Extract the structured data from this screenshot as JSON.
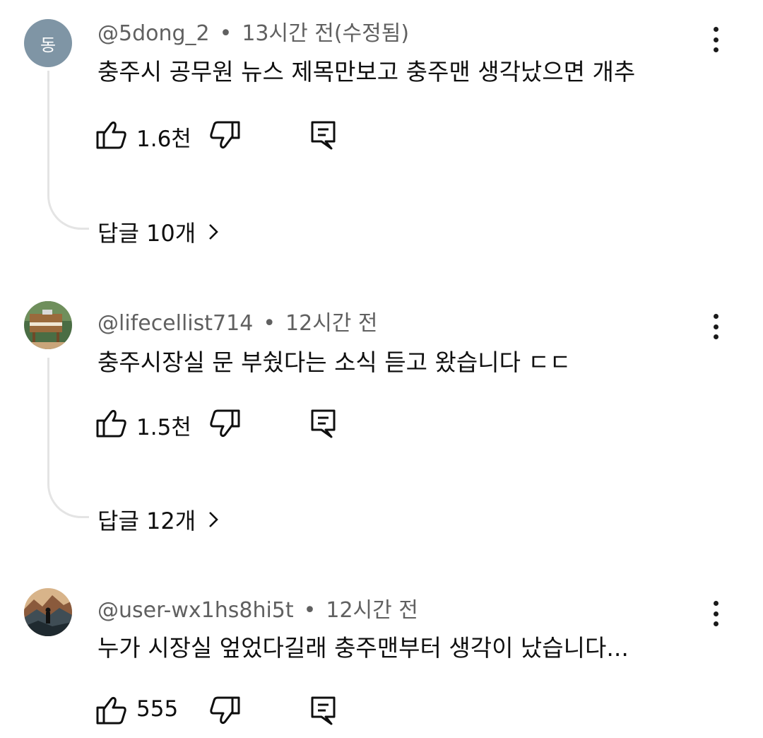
{
  "comments": [
    {
      "avatar_letter": "동",
      "avatar_color": "#7f95a5",
      "author": "@5dong_2",
      "separator": "•",
      "time": "13시간 전(수정됨)",
      "text": "충주시 공무원 뉴스 제목만보고 충주맨 생각났으면 개추",
      "likes": "1.6천",
      "replies_label": "답글 10개"
    },
    {
      "avatar_icon": "piano-avatar",
      "author": "@lifecellist714",
      "separator": "•",
      "time": "12시간 전",
      "text": "충주시장실 문 부쉈다는 소식 듣고 왔습니다 ㄷㄷ",
      "likes": "1.5천",
      "replies_label": "답글 12개"
    },
    {
      "avatar_icon": "mountain-avatar",
      "author": "@user-wx1hs8hi5t",
      "separator": "•",
      "time": "12시간 전",
      "text": "누가 시장실 엎었다길래 충주맨부터 생각이 났습니다...",
      "likes": "555"
    }
  ]
}
